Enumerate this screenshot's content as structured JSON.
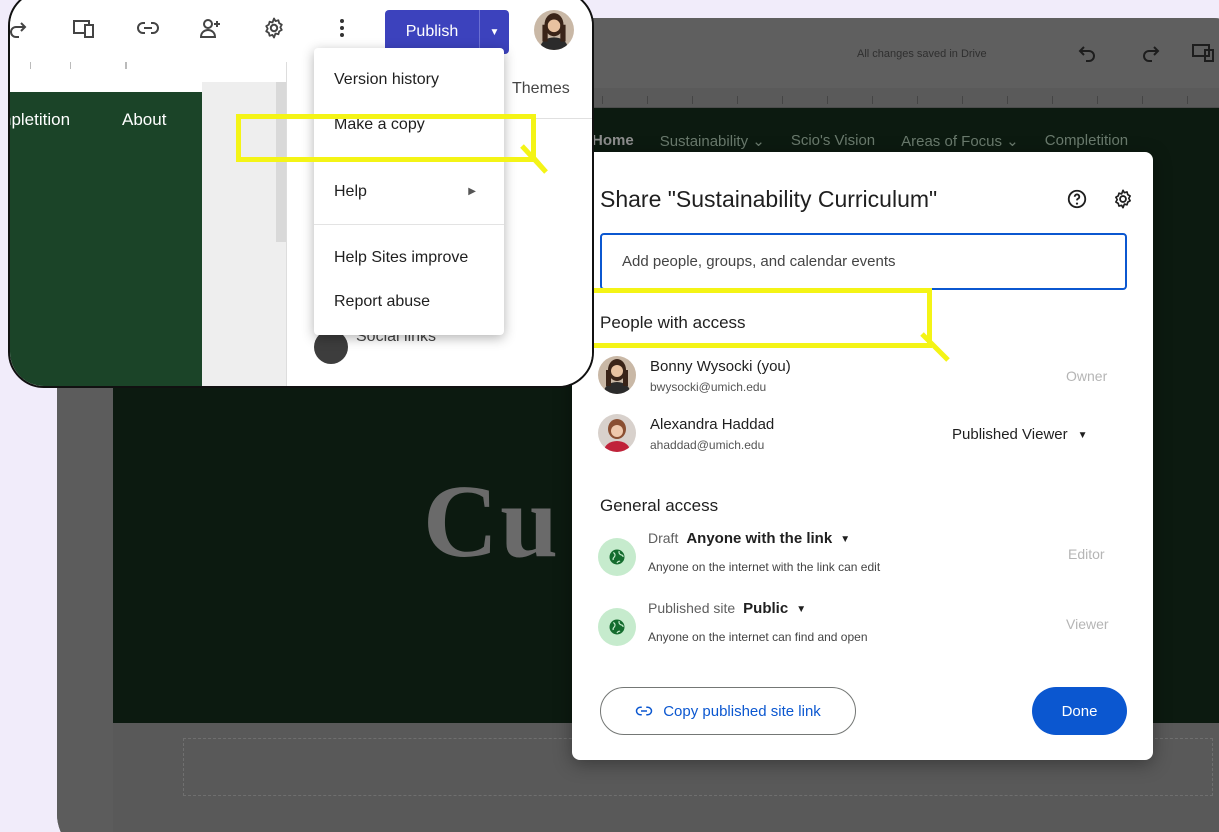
{
  "editor": {
    "saved_status": "All changes saved in Drive",
    "nav_items": [
      "Home",
      "Sustainability",
      "Scio's Vision",
      "Areas of Focus",
      "Completition"
    ],
    "hero_text": "Cu"
  },
  "callout": {
    "publish_label": "Publish",
    "nav_partial_a": "npletition",
    "nav_partial_b": "About",
    "themes_tab": "Themes",
    "social_links": "Social links",
    "menu": {
      "version_history": "Version history",
      "make_copy": "Make a copy",
      "help": "Help",
      "help_sites_improve": "Help Sites improve",
      "report_abuse": "Report abuse"
    }
  },
  "share": {
    "title": "Share \"Sustainability Curriculum\"",
    "input_placeholder": "Add people, groups, and calendar events",
    "people_heading": "People with access",
    "people": [
      {
        "name": "Bonny Wysocki (you)",
        "email": "bwysocki@umich.edu",
        "role": "Owner"
      },
      {
        "name": "Alexandra Haddad",
        "email": "ahaddad@umich.edu",
        "role": "Published Viewer"
      }
    ],
    "general_heading": "General access",
    "access": [
      {
        "label": "Draft",
        "value": "Anyone with the link",
        "desc": "Anyone on the internet with the link can edit",
        "role": "Editor"
      },
      {
        "label": "Published site",
        "value": "Public",
        "desc": "Anyone on the internet can find and open",
        "role": "Viewer"
      }
    ],
    "copy_link_label": "Copy published site link",
    "done_label": "Done"
  },
  "colors": {
    "accent_blue": "#0b57d0",
    "publish_indigo": "#3c42bd",
    "highlight_yellow": "#f4f416",
    "site_green": "#1b4428"
  }
}
